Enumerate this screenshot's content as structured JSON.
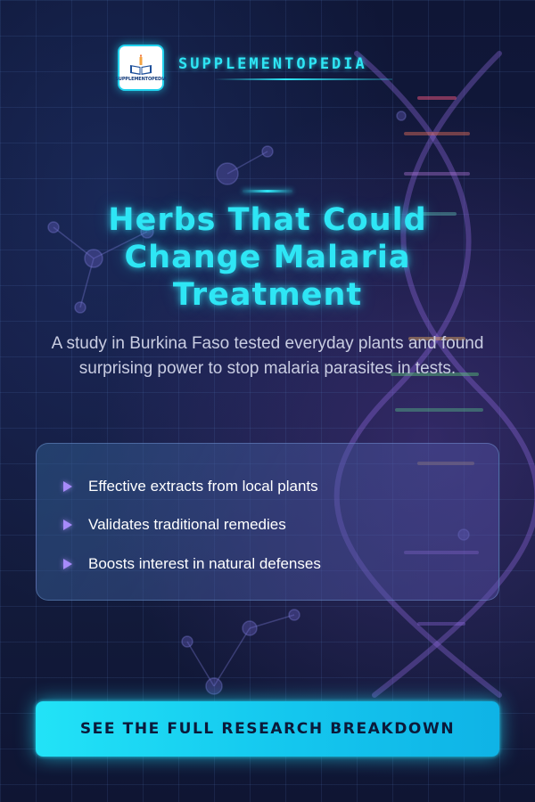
{
  "brand": {
    "name": "SUPPLEMENTOPEDIA",
    "logo_text": "SUPPLEMENTOPEDIA",
    "logo_icon": "book-candle-icon"
  },
  "hero": {
    "title_lines": [
      "Herbs That Could",
      "Change Malaria",
      "Treatment"
    ],
    "subtitle": "A study in Burkina Faso tested everyday plants and found surprising power to stop malaria parasites in tests."
  },
  "key_points": [
    {
      "icon": "triangle-bullet-icon",
      "text": "Effective extracts from local plants"
    },
    {
      "icon": "triangle-bullet-icon",
      "text": "Validates traditional remedies"
    },
    {
      "icon": "triangle-bullet-icon",
      "text": "Boosts interest in natural defenses"
    }
  ],
  "cta": {
    "label": "SEE THE FULL RESEARCH BREAKDOWN"
  },
  "colors": {
    "accent": "#2ee6f5",
    "background": "#0f1636",
    "bullet": "#a78bfa",
    "cta_text": "#0b1a3a"
  }
}
